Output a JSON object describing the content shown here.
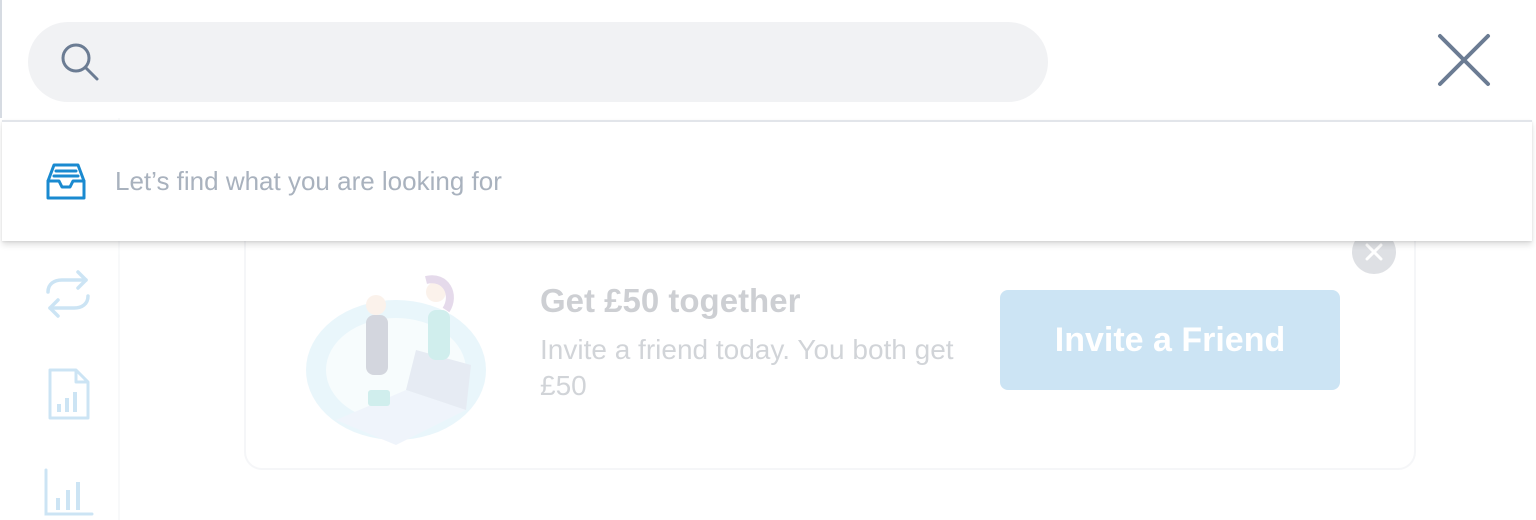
{
  "search": {
    "value": "",
    "placeholder": "",
    "empty_message": "Let’s find what you are looking for"
  },
  "icons": {
    "search": "search-icon",
    "close": "close-icon",
    "empty_state": "inbox-tray-icon"
  },
  "background": {
    "sidebar": {
      "icons": [
        "transfer-arrows-icon",
        "report-document-icon",
        "bar-chart-icon"
      ]
    },
    "promo": {
      "title": "Get £50 together",
      "description": "Invite a friend today. You both get £50",
      "button_label": "Invite a Friend"
    }
  },
  "colors": {
    "accent": "#1a8ad0",
    "search_bar_bg": "#f1f2f4",
    "muted_text": "#a9b2be"
  }
}
